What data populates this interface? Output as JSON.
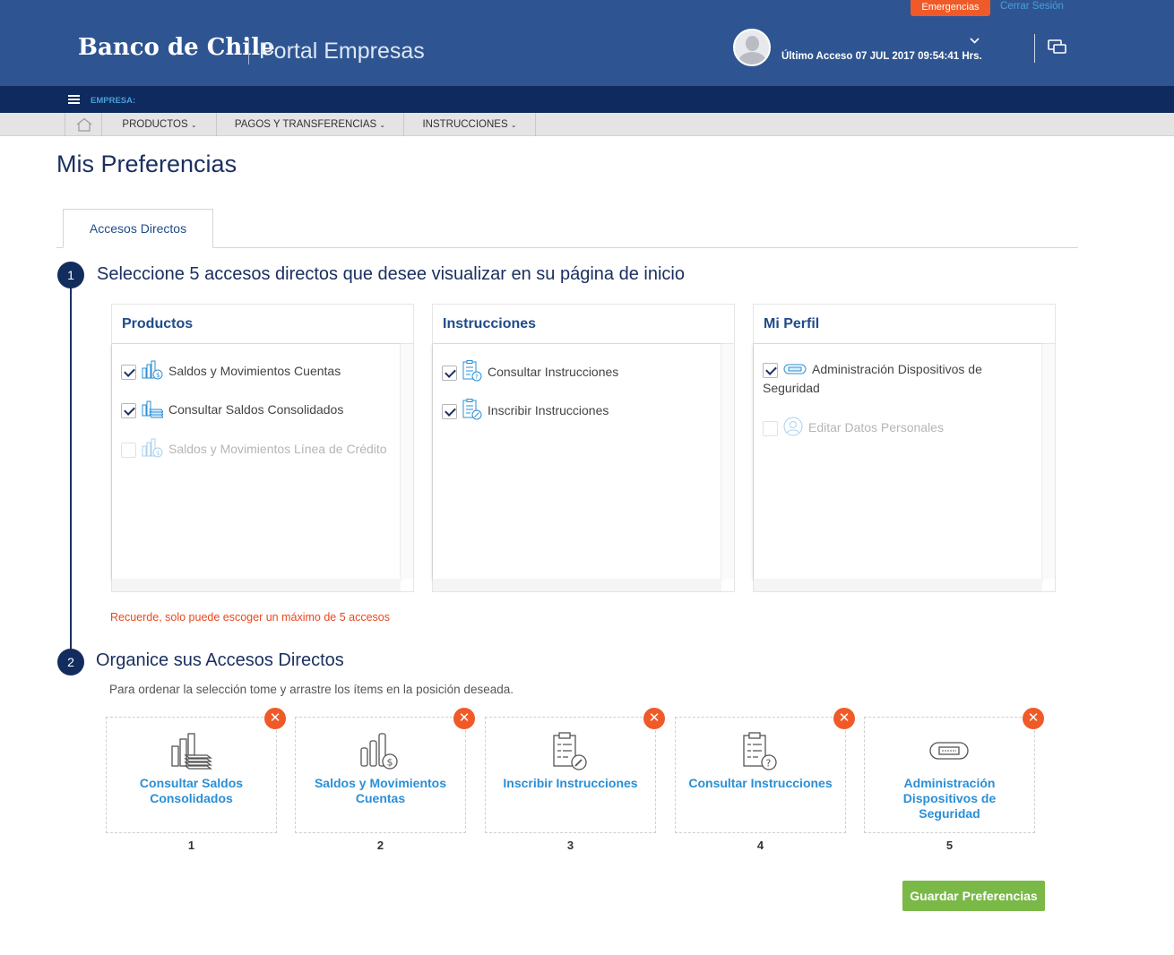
{
  "header": {
    "logo_text": "Banco de Chile",
    "portal": "Portal Empresas",
    "emergency_label": "Emergencias",
    "logout_label": "Cerrar Sesión",
    "last_access": "Último Acceso 07 JUL 2017 09:54:41 Hrs."
  },
  "company_bar": {
    "label": "EMPRESA:"
  },
  "nav": {
    "items": [
      {
        "label": "PRODUCTOS"
      },
      {
        "label": "PAGOS Y TRANSFERENCIAS"
      },
      {
        "label": "INSTRUCCIONES"
      }
    ]
  },
  "page": {
    "title": "Mis Preferencias",
    "tab": "Accesos Directos"
  },
  "step1": {
    "number": "1",
    "title": "Seleccione 5 accesos directos que desee visualizar en su página de inicio",
    "panels": [
      {
        "title": "Productos",
        "options": [
          {
            "label": "Saldos y Movimientos Cuentas",
            "checked": true,
            "icon": "bar-chart-dollar-icon"
          },
          {
            "label": "Consultar Saldos Consolidados",
            "checked": true,
            "icon": "stacked-money-icon"
          },
          {
            "label": "Saldos y Movimientos Línea de Crédito",
            "checked": false,
            "disabled": true,
            "icon": "bar-chart-dollar-icon"
          }
        ]
      },
      {
        "title": "Instrucciones",
        "options": [
          {
            "label": "Consultar Instrucciones",
            "checked": true,
            "icon": "clipboard-question-icon"
          },
          {
            "label": "Inscribir Instrucciones",
            "checked": true,
            "icon": "clipboard-pen-icon"
          }
        ]
      },
      {
        "title": "Mi Perfil",
        "options": [
          {
            "label_line1": "Administración Dispositivos de",
            "label_line2": "Seguridad",
            "checked": true,
            "icon": "security-token-icon"
          },
          {
            "label": "Editar Datos Personales",
            "checked": false,
            "disabled": true,
            "icon": "user-circle-icon"
          }
        ]
      }
    ],
    "notice": "Recuerde, solo puede escoger un máximo de 5 accesos"
  },
  "step2": {
    "number": "2",
    "title": "Organice sus Accesos Directos",
    "hint": "Para ordenar la selección tome y arrastre los ítems en la posición deseada.",
    "cards": [
      {
        "line1": "Consultar Saldos",
        "line2": "Consolidados",
        "line3": "",
        "position": "1",
        "icon": "stacked-money-icon"
      },
      {
        "line1": "Saldos y Movimientos",
        "line2": "Cuentas",
        "line3": "",
        "position": "2",
        "icon": "bar-chart-dollar-icon"
      },
      {
        "line1": "Inscribir Instrucciones",
        "line2": "",
        "line3": "",
        "position": "3",
        "icon": "clipboard-pen-icon"
      },
      {
        "line1": "Consultar Instrucciones",
        "line2": "",
        "line3": "",
        "position": "4",
        "icon": "clipboard-question-icon"
      },
      {
        "line1": "Administración",
        "line2": "Dispositivos de",
        "line3": "Seguridad",
        "position": "5",
        "icon": "security-token-icon"
      }
    ],
    "remove_glyph": "✕"
  },
  "actions": {
    "save_label": "Guardar Preferencias"
  },
  "colors": {
    "brand_header": "#2e5592",
    "dark_navy": "#0f2a5e",
    "accent_orange": "#f05a28",
    "link_blue": "#2a8fd6",
    "save_green": "#7ab848"
  }
}
